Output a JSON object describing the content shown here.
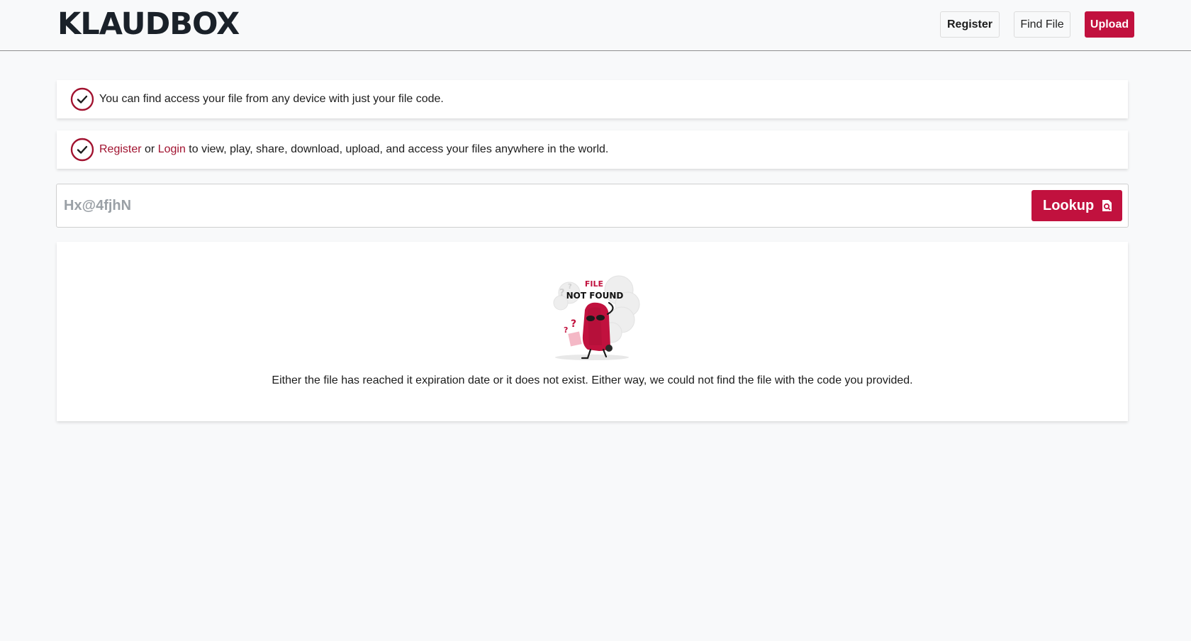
{
  "brand": {
    "logo_text": "KLAUDBOX"
  },
  "nav": {
    "register_label": "Register",
    "find_label": "Find File",
    "upload_label": "Upload"
  },
  "info": {
    "line1": "You can find access your file from any device with just your file code.",
    "line2_link_register": "Register",
    "line2_or": " or ",
    "line2_link_login": "Login",
    "line2_rest": " to view, play, share, download, upload, and access your files anywhere in the world."
  },
  "search": {
    "value": "Hx@4fjhN",
    "button_label": "Lookup"
  },
  "result": {
    "image_title_top": "FILE",
    "image_title_bottom": "NOT FOUND",
    "message": "Either the file has reached it expiration date or it does not exist. Either way, we could not find the file with the code you provided."
  },
  "colors": {
    "accent": "#c1113e",
    "link": "#a1122f",
    "logo": "#1a2129",
    "background": "#f8f9fa"
  },
  "icons": {
    "check": "check-circle-icon",
    "lookup": "search-file-icon"
  }
}
